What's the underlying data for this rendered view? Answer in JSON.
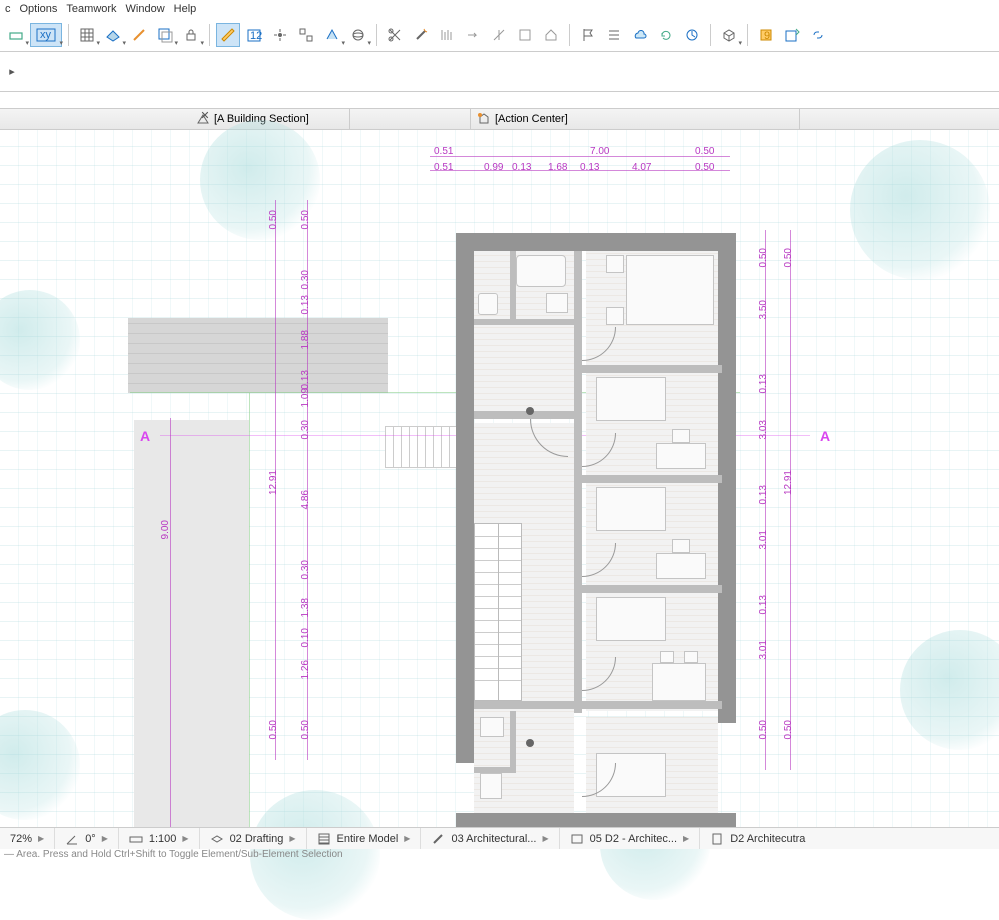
{
  "menu": {
    "items": [
      "c",
      "Options",
      "Teamwork",
      "Window",
      "Help"
    ]
  },
  "tabs": {
    "close_x": "×",
    "building_section": "[A Building Section]",
    "action_center": "[Action Center]"
  },
  "dims": {
    "top_row1": [
      "0.51",
      "7.00",
      "0.50"
    ],
    "top_row2": [
      "0.51",
      "0.99",
      "0.13",
      "1.68",
      "0.13",
      "4.07",
      "0.50"
    ],
    "left_col": [
      "0.50",
      "0.50",
      "0.13",
      "1.88",
      "0.13",
      "1.09",
      "0.30",
      "12.91",
      "4.86",
      "0.30",
      "1.38",
      "0.10",
      "1.26",
      "0.50",
      "0.50",
      "9.00"
    ],
    "right_col": [
      "0.50",
      "0.50",
      "3.50",
      "0.13",
      "3.03",
      "12.91",
      "0.13",
      "3.01",
      "0.13",
      "3.01",
      "0.50",
      "0.50"
    ]
  },
  "section_marker": "A",
  "status": {
    "zoom": "72%",
    "angle": "0°",
    "scale": "1:100",
    "layer": "02 Drafting",
    "model": "Entire Model",
    "arch": "03 Architectural...",
    "view": "05 D2 - Architec...",
    "sheet": "D2 Architecutra"
  },
  "hint": "— Area. Press and Hold Ctrl+Shift to Toggle Element/Sub-Element Selection"
}
